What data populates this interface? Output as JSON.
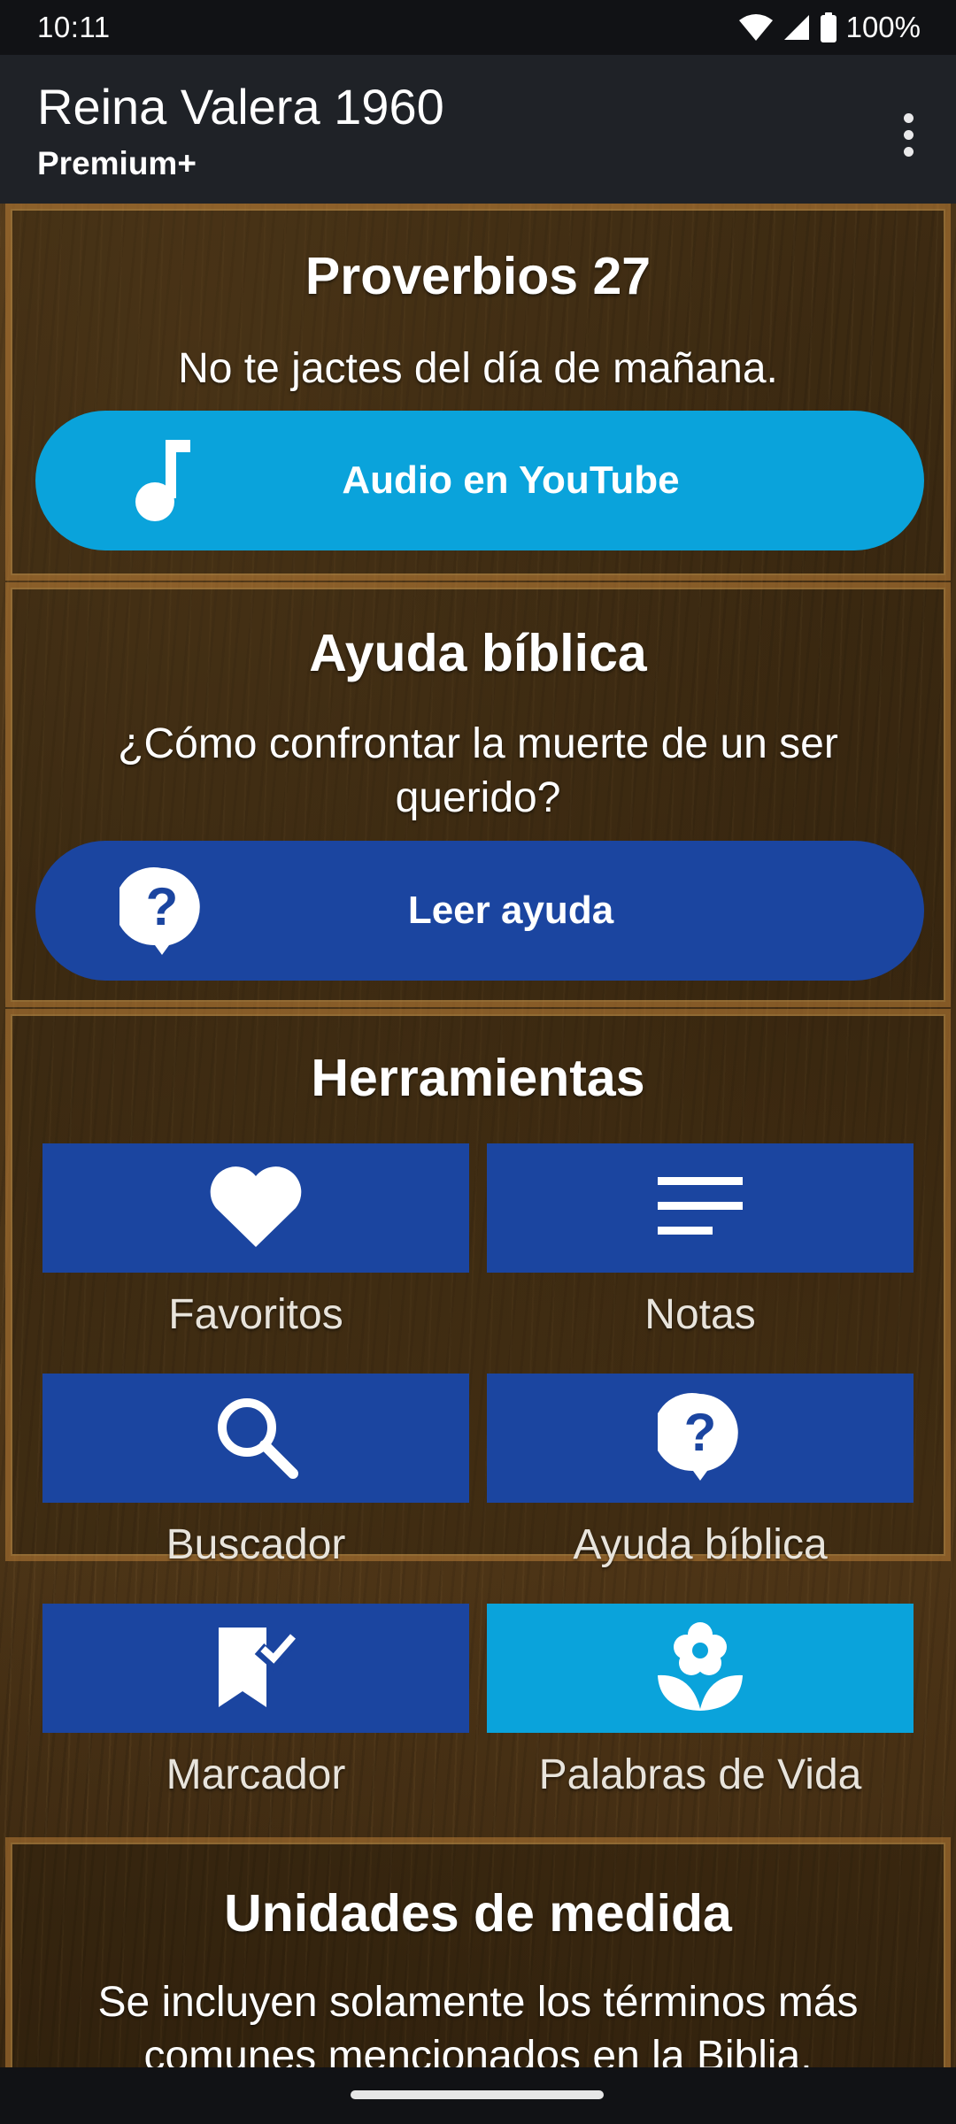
{
  "status_bar": {
    "time": "10:11",
    "battery": "100%",
    "icons": [
      "wifi-icon",
      "cell-signal-icon",
      "battery-icon"
    ]
  },
  "app_bar": {
    "title": "Reina Valera 1960",
    "subtitle": "Premium+",
    "menu_icon": "more-vert-icon"
  },
  "verse_card": {
    "title": "Proverbios 27",
    "text": "No te jactes del día de mañana.",
    "button_label": "Audio en YouTube",
    "button_icon": "music-note-icon",
    "button_color": "#0aa3db"
  },
  "help_card": {
    "title": "Ayuda bíblica",
    "text": "¿Cómo confrontar la muerte de un ser querido?",
    "button_label": "Leer ayuda",
    "button_icon": "question-bubble-icon",
    "button_color": "#1b45a0"
  },
  "tools_card": {
    "title": "Herramientas",
    "items": [
      {
        "label": "Favoritos",
        "icon": "heart-icon",
        "color": "#1b45a0"
      },
      {
        "label": "Notas",
        "icon": "notes-lines-icon",
        "color": "#1b45a0"
      },
      {
        "label": "Buscador",
        "icon": "search-icon",
        "color": "#1b45a0"
      },
      {
        "label": "Ayuda bíblica",
        "icon": "question-bubble-icon",
        "color": "#1b45a0"
      },
      {
        "label": "Marcador",
        "icon": "bookmark-check-icon",
        "color": "#1b45a0"
      },
      {
        "label": "Palabras de Vida",
        "icon": "flower-icon",
        "color": "#0aa3db"
      }
    ]
  },
  "units_card": {
    "title": "Unidades de medida",
    "text": "Se incluyen solamente los términos más comunes mencionados en la Biblia."
  }
}
